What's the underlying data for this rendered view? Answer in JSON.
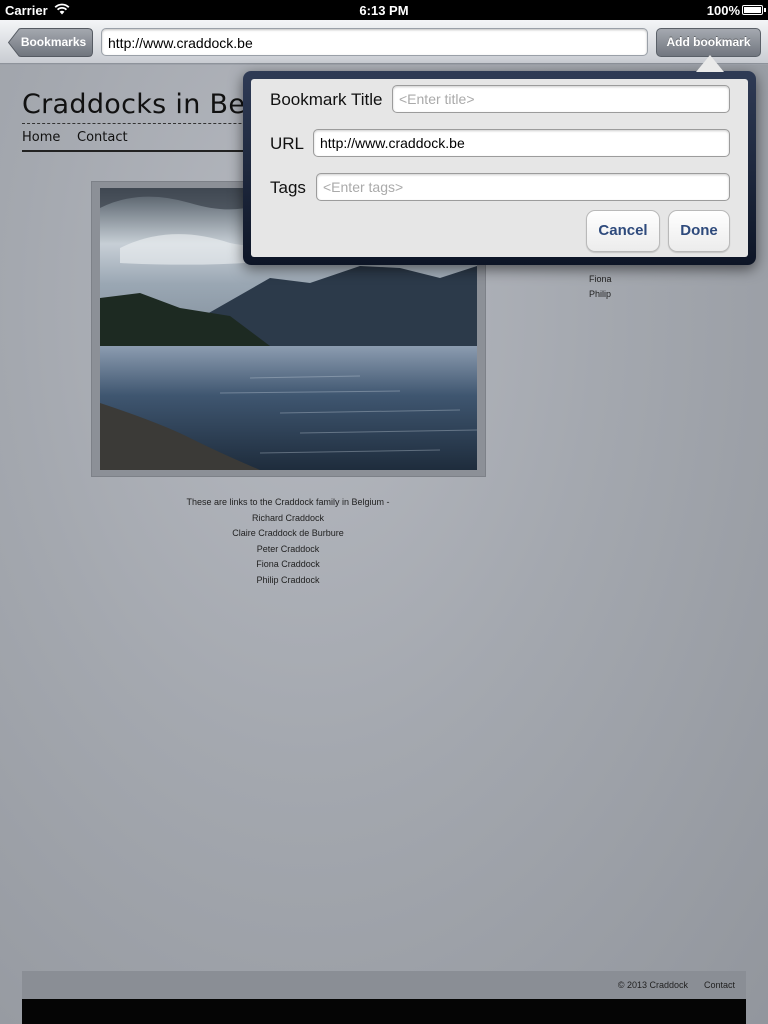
{
  "status_bar": {
    "carrier": "Carrier",
    "time": "6:13 PM",
    "battery": "100%"
  },
  "toolbar": {
    "bookmarks_label": "Bookmarks",
    "url": "http://www.craddock.be",
    "add_bookmark_label": "Add bookmark"
  },
  "page": {
    "site_title": "Craddocks in Belgium",
    "nav": [
      "Home",
      "Contact"
    ],
    "side_links": [
      "Fiona",
      "Philip"
    ],
    "intro": "These are links to the Craddock family in Belgium -",
    "family_links": [
      "Richard Craddock",
      "Claire Craddock de Burbure",
      "Peter Craddock",
      "Fiona Craddock",
      "Philip Craddock"
    ],
    "footer_copyright": "© 2013 Craddock",
    "footer_contact": "Contact"
  },
  "popover": {
    "title_label": "Bookmark Title",
    "title_placeholder": "<Enter title>",
    "url_label": "URL",
    "url_value": "http://www.craddock.be",
    "tags_label": "Tags",
    "tags_placeholder": "<Enter tags>",
    "cancel_label": "Cancel",
    "done_label": "Done"
  },
  "colors": {
    "link_blue": "#2e4a7c",
    "popover_frame": "#0d1526"
  }
}
